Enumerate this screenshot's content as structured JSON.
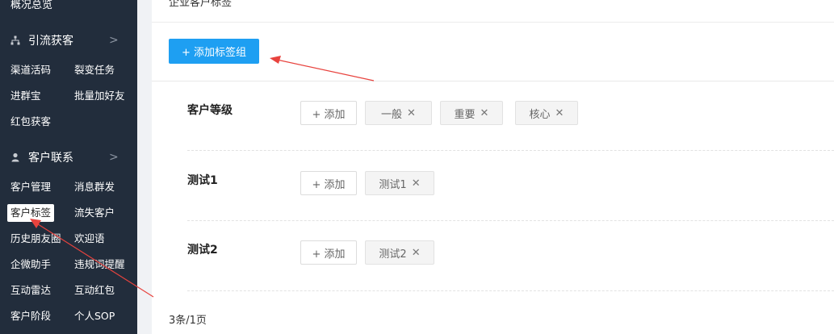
{
  "sidebar": {
    "top_item": "概况总览",
    "sections": [
      {
        "title": "引流获客",
        "icon": "sitemap-icon",
        "items": [
          "渠道活码",
          "裂变任务",
          "进群宝",
          "批量加好友",
          "红包获客"
        ]
      },
      {
        "title": "客户联系",
        "icon": "user-icon",
        "items": [
          "客户管理",
          "消息群发",
          "客户标签",
          "流失客户",
          "历史朋友圈",
          "欢迎语",
          "企微助手",
          "违规词提醒",
          "互动雷达",
          "互动红包",
          "客户阶段",
          "个人SOP"
        ]
      }
    ],
    "active_item": "客户标签",
    "chevron": ">"
  },
  "main": {
    "header_title": "企业客户标签",
    "add_group_label": "+ 添加标签组",
    "add_tag_label": "+ 添加",
    "close_glyph": "✕",
    "groups": [
      {
        "name": "客户等级",
        "tags": [
          "一般",
          "重要",
          "核心"
        ]
      },
      {
        "name": "测试1",
        "tags": [
          "测试1"
        ]
      },
      {
        "name": "测试2",
        "tags": [
          "测试2"
        ]
      }
    ],
    "pagination": "3条/1页"
  },
  "colors": {
    "sidebar_bg": "#222d3c",
    "primary": "#1e9ff2",
    "annotation_arrow": "#e8433e"
  }
}
